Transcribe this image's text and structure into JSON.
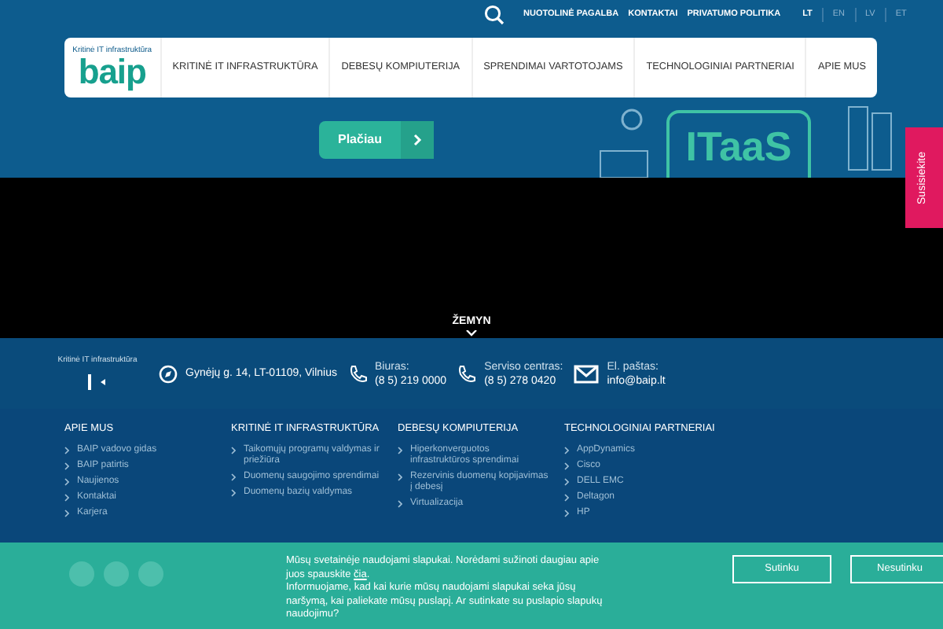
{
  "top_links": [
    "NUOTOLINĖ PAGALBA",
    "KONTAKTAI",
    "PRIVATUMO POLITIKA"
  ],
  "languages": [
    {
      "label": "LT",
      "selected": true
    },
    {
      "label": "EN",
      "selected": false
    },
    {
      "label": "LV",
      "selected": false
    },
    {
      "label": "ET",
      "selected": false
    }
  ],
  "logo": {
    "tagline": "Kritinė IT infrastruktūra",
    "name": "baip"
  },
  "nav": [
    "KRITINĖ IT INFRASTRUKTŪRA",
    "DEBESŲ KOMPIUTERIJA",
    "SPRENDIMAI VARTOTOJAMS",
    "TECHNOLOGINIAI PARTNERIAI",
    "APIE MUS"
  ],
  "hero": {
    "button": "Plačiau",
    "illustration_label": "ITaaS"
  },
  "side_tab": "Susisiekite",
  "scroll_down": "ŽEMYN",
  "footer_logo_tagline": "Kritinė IT infrastruktūra",
  "contacts": [
    {
      "kind": "address",
      "lines": [
        "Gynėjų g. 14, LT-01109, Vilnius"
      ]
    },
    {
      "kind": "phone",
      "lines": [
        "Biuras:",
        "(8 5) 219 0000"
      ]
    },
    {
      "kind": "phone",
      "lines": [
        "Serviso centras:",
        "(8 5) 278 0420"
      ]
    },
    {
      "kind": "mail",
      "lines": [
        "El. paštas:",
        "info@baip.lt"
      ]
    }
  ],
  "footer_columns": [
    {
      "title": "APIE MUS",
      "items": [
        "BAIP vadovo gidas",
        "BAIP patirtis",
        "Naujienos",
        "Kontaktai",
        "Karjera"
      ]
    },
    {
      "title": "KRITINĖ IT INFRASTRUKTŪRA",
      "items": [
        "Taikomųjų programų valdymas ir priežiūra",
        "Duomenų saugojimo sprendimai",
        "Duomenų bazių valdymas"
      ]
    },
    {
      "title": "DEBESŲ KOMPIUTERIJA",
      "items": [
        "Hiperkonverguotos infrastruktūros sprendimai",
        "Rezervinis duomenų kopijavimas į debesį",
        "Virtualizacija"
      ]
    },
    {
      "title": "TECHNOLOGINIAI PARTNERIAI",
      "items": [
        "AppDynamics",
        "Cisco",
        "DELL EMC",
        "Deltagon",
        "HP"
      ]
    }
  ],
  "cookie": {
    "text_before_link": "Mūsų svetainėje naudojami slapukai. Norėdami sužinoti daugiau apie juos spauskite",
    "link": "čia",
    "text_after_link": ".",
    "text_2": "Informuojame, kad kai kurie mūsų naudojami slapukai seka jūsų naršymą, kai paliekate mūsų puslapį. Ar sutinkate su puslapio slapukų naudojimu?",
    "buttons": [
      "Sutinku",
      "Nesutinku"
    ]
  }
}
